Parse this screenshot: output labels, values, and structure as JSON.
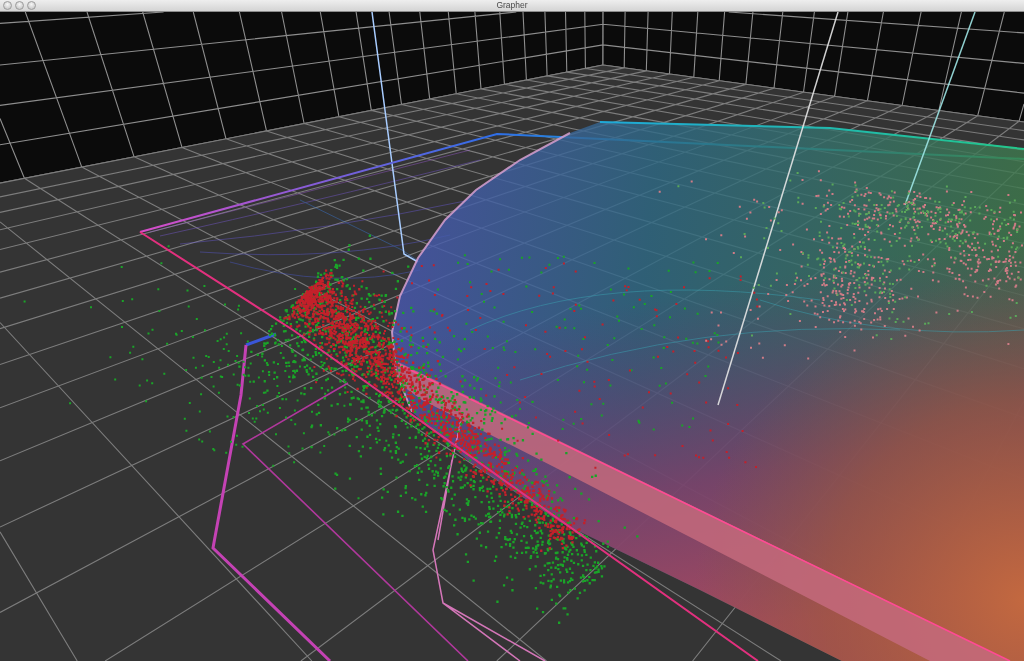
{
  "window": {
    "title": "Grapher"
  }
}
